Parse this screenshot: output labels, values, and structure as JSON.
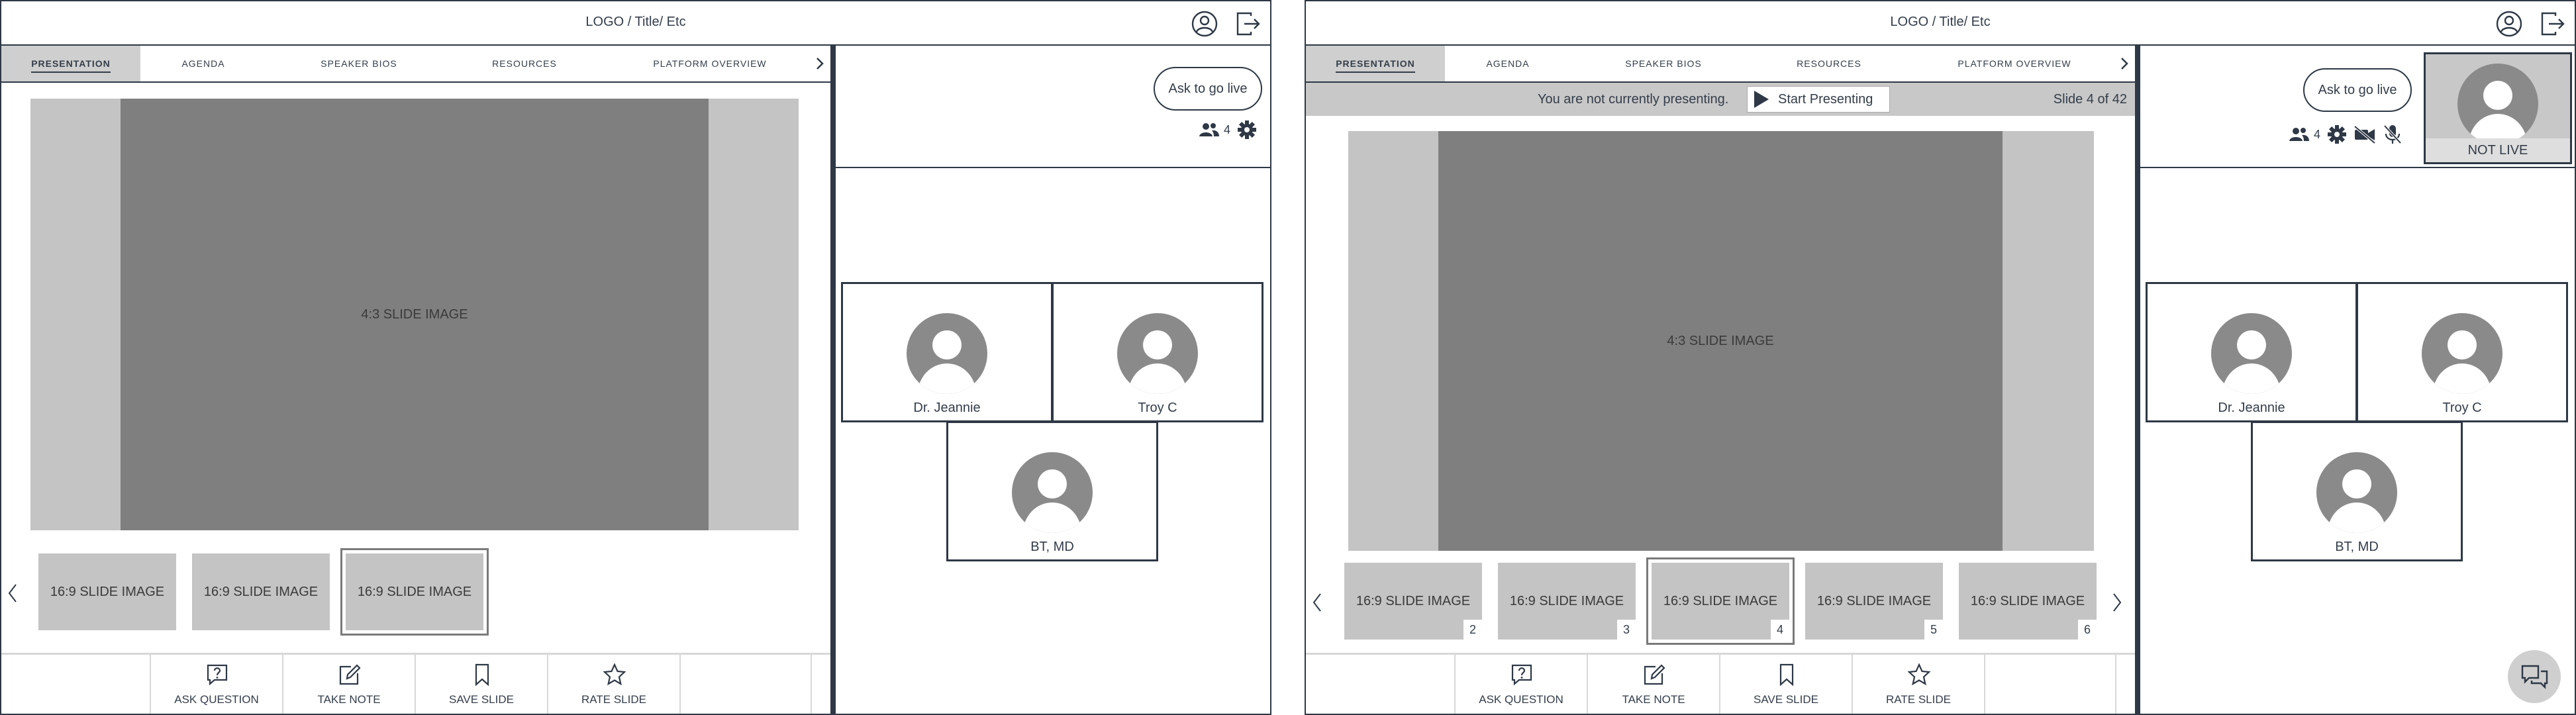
{
  "app": {
    "title": "LOGO / Title/ Etc"
  },
  "tabs": [
    {
      "label": "PRESENTATION"
    },
    {
      "label": "AGENDA"
    },
    {
      "label": "SPEAKER BIOS"
    },
    {
      "label": "RESOURCES"
    },
    {
      "label": "PLATFORM OVERVIEW"
    }
  ],
  "icons": {
    "profile": "user-circle-icon",
    "logout": "logout-icon",
    "tab_more": "chevron-right-icon",
    "attendees": "people-icon",
    "settings": "gear-icon",
    "camera_off": "camera-off-icon",
    "mic_off": "mic-off-icon",
    "chat": "chat-icon"
  },
  "presenter_status": {
    "text": "You are not currently presenting.",
    "start_button": "Start Presenting",
    "slide_counter": "Slide 4 of 42"
  },
  "main_slide": {
    "label": "4:3 SLIDE IMAGE"
  },
  "left_view": {
    "thumbnails": [
      {
        "label": "16:9 SLIDE IMAGE"
      },
      {
        "label": "16:9 SLIDE IMAGE"
      },
      {
        "label": "16:9 SLIDE IMAGE"
      }
    ]
  },
  "right_view": {
    "thumbnails": [
      {
        "label": "16:9 SLIDE IMAGE",
        "number": "2"
      },
      {
        "label": "16:9 SLIDE IMAGE",
        "number": "3"
      },
      {
        "label": "16:9 SLIDE IMAGE",
        "number": "4"
      },
      {
        "label": "16:9 SLIDE IMAGE",
        "number": "5"
      },
      {
        "label": "16:9 SLIDE IMAGE",
        "number": "6"
      }
    ],
    "preview_label": "NOT LIVE"
  },
  "bottom_actions": [
    {
      "label": "ASK QUESTION"
    },
    {
      "label": "TAKE NOTE"
    },
    {
      "label": "SAVE SLIDE"
    },
    {
      "label": "RATE SLIDE"
    }
  ],
  "side": {
    "ask_live": "Ask to go live",
    "attendee_count": "4"
  },
  "participants": [
    {
      "name": "Dr. Jeannie"
    },
    {
      "name": "Troy C"
    },
    {
      "name": "BT, MD"
    }
  ],
  "colors": {
    "border": "#2e3846",
    "slide_bg": "#c4c4c4",
    "slide_inner": "#7f7f7f",
    "avatar": "#8a8a8a",
    "tab_active": "#cfcfcf"
  }
}
